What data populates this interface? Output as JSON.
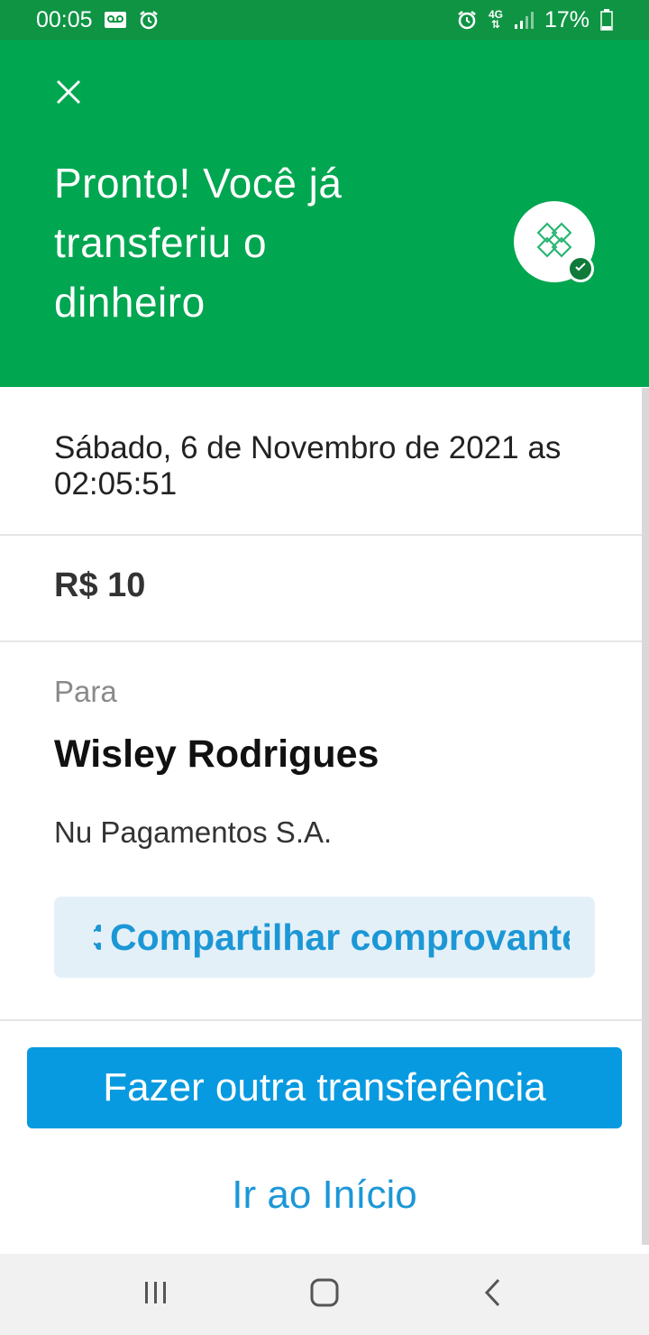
{
  "status_bar": {
    "time": "00:05",
    "battery": "17%",
    "network": "4G",
    "icons": [
      "voicemail-icon",
      "alarm-icon",
      "alarm-icon",
      "signal-icon",
      "battery-icon"
    ]
  },
  "header": {
    "title": "Pronto! Você já transferiu o dinheiro",
    "close_icon": "close-icon",
    "logo_icon": "pix-logo-icon",
    "badge_icon": "check-icon",
    "background": "#00a650"
  },
  "transfer": {
    "datetime": "Sábado, 6 de Novembro de 2021 as 02:05:51",
    "amount": "R$ 10",
    "to_label": "Para",
    "recipient_name": "Wisley Rodrigues",
    "recipient_bank": "Nu Pagamentos S.A."
  },
  "actions": {
    "share_label": "Compartilhar comprovante",
    "new_transfer_label": "Fazer outra transferência",
    "home_label": "Ir ao Início",
    "accent": "#079ae0"
  },
  "nav_bar": {
    "icons": [
      "recent-apps-icon",
      "home-icon",
      "back-icon"
    ]
  }
}
